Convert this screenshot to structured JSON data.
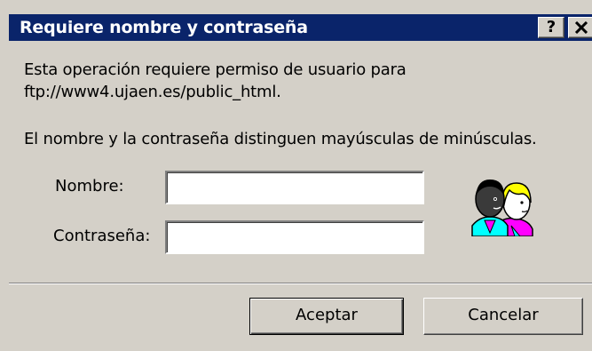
{
  "window": {
    "title": "Requiere nombre y contraseña",
    "help_button": "?",
    "close_button": "✕",
    "title_bar_color": "#0a246a",
    "face_color": "#d4d0c8"
  },
  "message": {
    "line1": "Esta operación requiere permiso de usuario para",
    "line2": "ftp://www4.ujaen.es/public_html.",
    "line3": "El nombre y la contraseña distinguen mayúsculas de minúsculas."
  },
  "form": {
    "name_label": "Nombre:",
    "name_value": "",
    "password_label": "Contraseña:",
    "password_value": ""
  },
  "icon": {
    "name": "users-icon"
  },
  "buttons": {
    "ok": "Aceptar",
    "cancel": "Cancelar"
  }
}
